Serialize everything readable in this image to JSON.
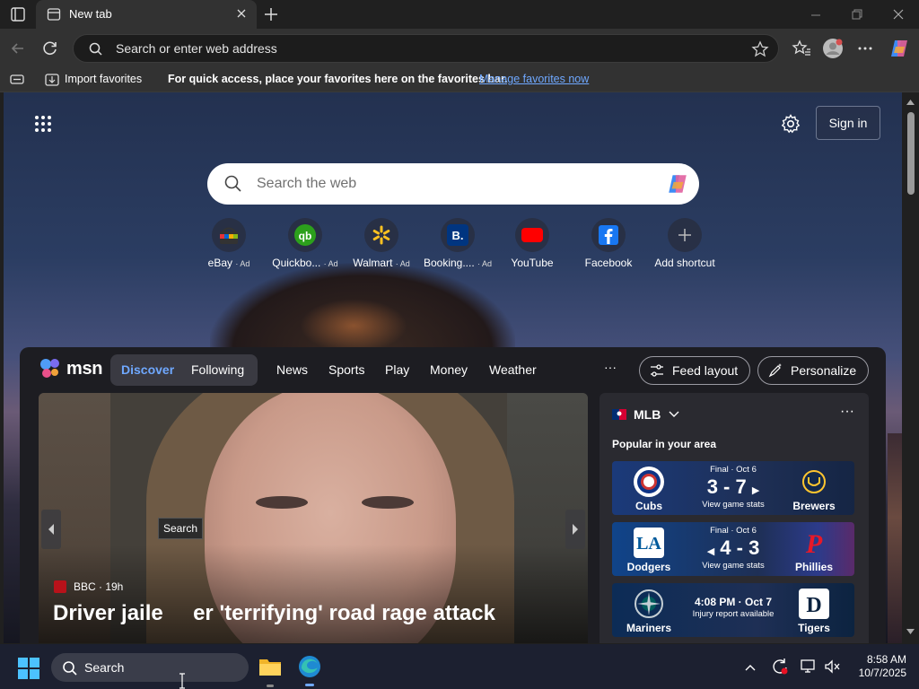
{
  "browser": {
    "tab_title": "New tab",
    "address_placeholder": "Search or enter web address"
  },
  "favorites_bar": {
    "import_label": "Import favorites",
    "hint": "For quick access, place your favorites here on the favorites bar.",
    "manage_link": "Manage favorites now"
  },
  "newtab": {
    "signin_label": "Sign in",
    "search_placeholder": "Search the web",
    "shortcuts": [
      {
        "label": "eBay",
        "ad": "· Ad"
      },
      {
        "label": "Quickbo...",
        "ad": "· Ad"
      },
      {
        "label": "Walmart",
        "ad": "· Ad"
      },
      {
        "label": "Booking....",
        "ad": "· Ad"
      },
      {
        "label": "YouTube",
        "ad": ""
      },
      {
        "label": "Facebook",
        "ad": ""
      },
      {
        "label": "Add shortcut",
        "ad": ""
      }
    ]
  },
  "feed": {
    "logo_text": "msn",
    "tabs": [
      "Discover",
      "Following"
    ],
    "nav": [
      "News",
      "Sports",
      "Play",
      "Money",
      "Weather"
    ],
    "more": "···",
    "feed_layout_label": "Feed layout",
    "personalize_label": "Personalize",
    "hero": {
      "source": "BBC · 19h",
      "headline": "Driver jaile     er 'terrifying' road rage attack",
      "tooltip": "Search"
    },
    "sports": {
      "league": "MLB",
      "subtitle": "Popular in your area",
      "games": [
        {
          "status": "Final · Oct 6",
          "score": "3 - 7",
          "detail": "View game stats",
          "home": "Cubs",
          "away": "Brewers"
        },
        {
          "status": "Final · Oct 6",
          "score": "4 - 3",
          "detail": "View game stats",
          "home": "Dodgers",
          "away": "Phillies"
        },
        {
          "status": "4:08 PM · Oct 7",
          "score": "",
          "detail": "Injury report available",
          "home": "Mariners",
          "away": "Tigers"
        }
      ]
    }
  },
  "taskbar": {
    "search_label": "Search",
    "time": "8:58 AM",
    "date": "10/7/2025"
  },
  "colors": {
    "accent_link": "#6fa8ff",
    "cubs_blue": "#0e3386",
    "brewers_navy": "#12284b",
    "dodgers_blue": "#005a9c",
    "phillies_red": "#e81828",
    "mariners_navy": "#0c2c56",
    "tigers_navy": "#0c2340"
  }
}
